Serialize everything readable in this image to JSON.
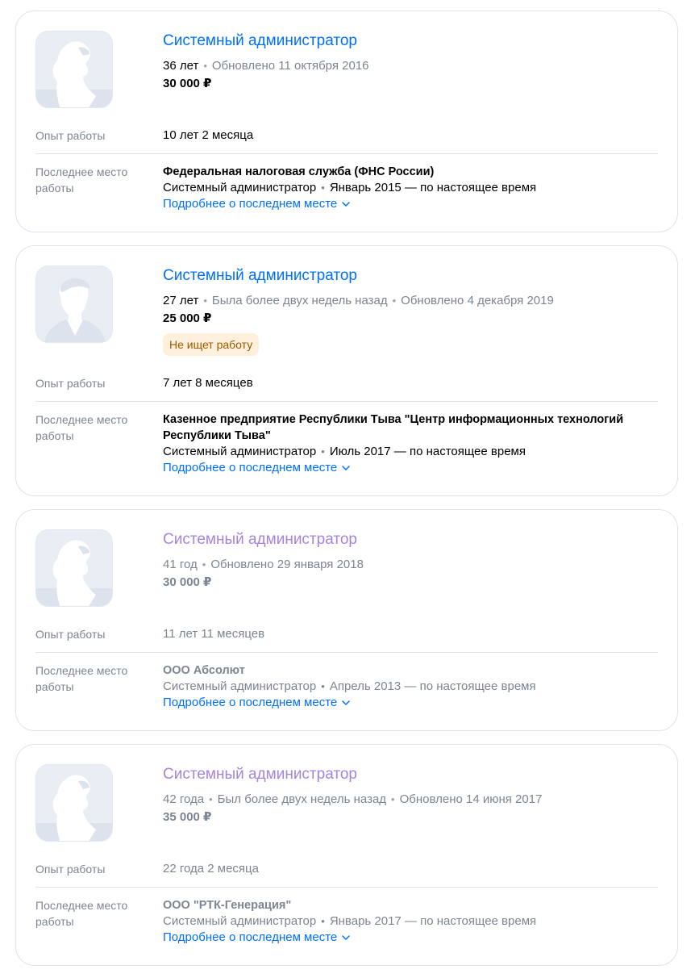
{
  "colors": {
    "link": "#0070ff",
    "visited_link": "#a684e0",
    "muted": "#7d8592",
    "badge_bg": "#fff0dc",
    "badge_text": "#9b5a00"
  },
  "labels": {
    "experience": "Опыт работы",
    "last_job": "Последнее место работы",
    "more": "Подробнее о последнем месте"
  },
  "resumes": [
    {
      "title": "Системный администратор",
      "age": "36 лет",
      "updated": "Обновлено 11 октября 2016",
      "salary": "30 000 ₽",
      "experience": "10 лет 2 месяца",
      "company": "Федеральная налоговая служба (ФНС России)",
      "position": "Системный администратор",
      "period": "Январь 2015 — по настоящее время"
    },
    {
      "title": "Системный администратор",
      "age": "27 лет",
      "last_seen": "Была более двух недель назад",
      "updated": "Обновлено 4 декабря 2019",
      "salary": "25 000 ₽",
      "badge": "Не ищет работу",
      "experience": "7 лет 8 месяцев",
      "company": "Казенное предприятие Республики Тыва \"Центр информационных технологий Республики Тыва\"",
      "position": "Системный администратор",
      "period": "Июль 2017 — по настоящее время"
    },
    {
      "title": "Системный администратор",
      "age": "41 год",
      "updated": "Обновлено 29 января 2018",
      "salary": "30 000 ₽",
      "experience": "11 лет 11 месяцев",
      "company": "ООО Абсолют",
      "position": "Системный администратор",
      "period": "Апрель 2013 — по настоящее время"
    },
    {
      "title": "Системный администратор",
      "age": "42 года",
      "last_seen": "Был более двух недель назад",
      "updated": "Обновлено 14 июня 2017",
      "salary": "35 000 ₽",
      "experience": "22 года 2 месяца",
      "company": "ООО \"РТК-Генерация\"",
      "position": "Системный администратор",
      "period": "Январь 2017 — по настоящее время"
    }
  ]
}
